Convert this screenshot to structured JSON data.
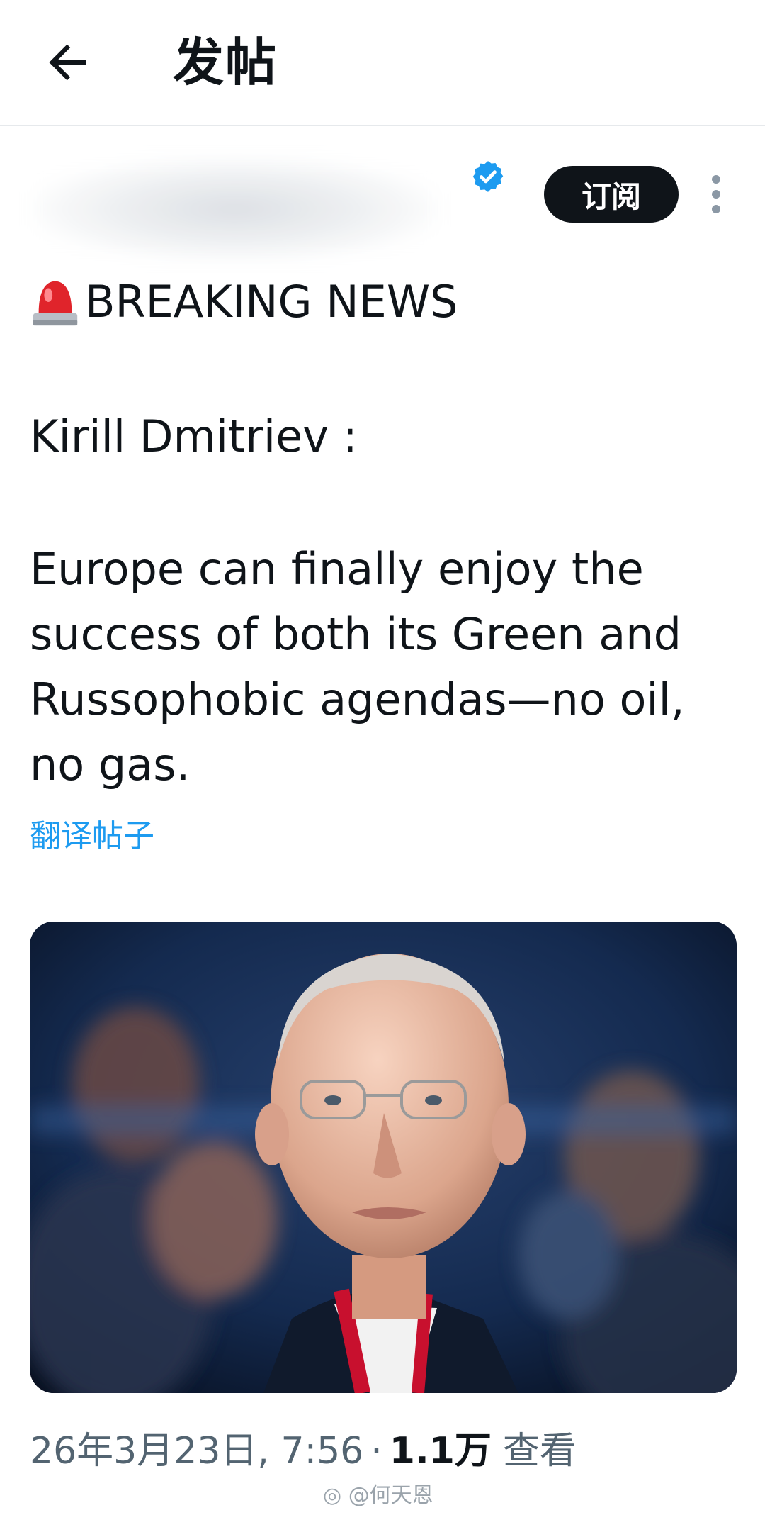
{
  "header": {
    "title": "发帖",
    "back_icon": "arrow-left-icon"
  },
  "author": {
    "verified_icon": "verified-badge-icon",
    "verified_color": "#1d9bf0"
  },
  "actions": {
    "subscribe_label": "订阅",
    "more_icon": "more-vertical-icon"
  },
  "tweet": {
    "breaking_emoji": "police-siren-icon",
    "breaking_text": "BREAKING NEWS",
    "name_line": "Kirill Dmitriev :",
    "body_lines": [
      "Europe can finally enjoy the",
      "success of both its Green and",
      "Russophobic agendas—no oil,",
      "no gas."
    ],
    "translate_label": "翻译帖子"
  },
  "media": {
    "photo": "portrait-photo"
  },
  "meta": {
    "date": "26年3月23日, 7:56",
    "separator": "·",
    "views_count": "1.1万",
    "views_label": "查看"
  },
  "watermark": {
    "text": "@何天恩",
    "icon": "weibo-icon"
  },
  "colors": {
    "accent": "#1d9bf0",
    "text": "#0f1419",
    "secondary": "#536471",
    "button_bg": "#0f1419"
  }
}
